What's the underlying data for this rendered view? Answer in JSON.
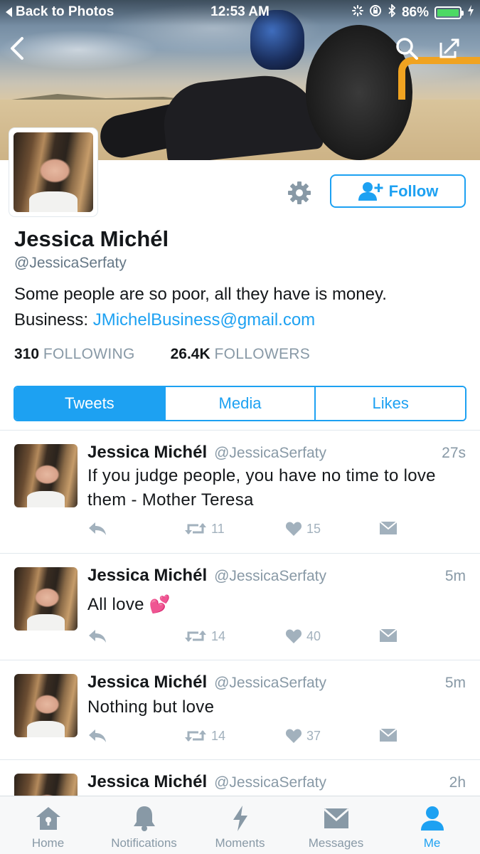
{
  "status_bar": {
    "back_label": "Back to Photos",
    "time": "12:53 AM",
    "battery": "86%"
  },
  "icons": {
    "back": "chevron-left-icon",
    "search": "search-icon",
    "compose": "compose-icon",
    "settings": "gear-icon",
    "follow": "add-user-icon",
    "reply": "reply-icon",
    "retweet": "retweet-icon",
    "like": "heart-icon",
    "message": "envelope-icon"
  },
  "colors": {
    "accent": "#1da1f2",
    "text": "#14171a",
    "muted": "#8899a6",
    "battery": "#4cd964"
  },
  "profile": {
    "name": "Jessica Michél",
    "handle": "@JessicaSerfaty",
    "bio_line1": "Some people are so poor, all they have is money.",
    "bio_business_label": "Business: ",
    "bio_email": "JMichelBusiness@gmail.com",
    "following_count": "310",
    "following_label": "FOLLOWING",
    "followers_count": "26.4K",
    "followers_label": "FOLLOWERS",
    "follow_button": "Follow"
  },
  "tabs": [
    {
      "label": "Tweets",
      "active": true
    },
    {
      "label": "Media",
      "active": false
    },
    {
      "label": "Likes",
      "active": false
    }
  ],
  "tweets": [
    {
      "name": "Jessica Michél",
      "handle": "@JessicaSerfaty",
      "time": "27s",
      "text": "If you judge people, you have no time to love them - Mother Teresa",
      "retweets": "11",
      "likes": "15"
    },
    {
      "name": "Jessica Michél",
      "handle": "@JessicaSerfaty",
      "time": "5m",
      "text": "All love 💕",
      "retweets": "14",
      "likes": "40"
    },
    {
      "name": "Jessica Michél",
      "handle": "@JessicaSerfaty",
      "time": "5m",
      "text": "Nothing but love",
      "retweets": "14",
      "likes": "37"
    },
    {
      "name": "Jessica Michél",
      "handle": "@JessicaSerfaty",
      "time": "2h"
    }
  ],
  "tab_bar": [
    {
      "label": "Home",
      "icon": "home-icon",
      "active": false
    },
    {
      "label": "Notifications",
      "icon": "bell-icon",
      "active": false
    },
    {
      "label": "Moments",
      "icon": "lightning-icon",
      "active": false
    },
    {
      "label": "Messages",
      "icon": "envelope-icon",
      "active": false
    },
    {
      "label": "Me",
      "icon": "person-icon",
      "active": true
    }
  ]
}
